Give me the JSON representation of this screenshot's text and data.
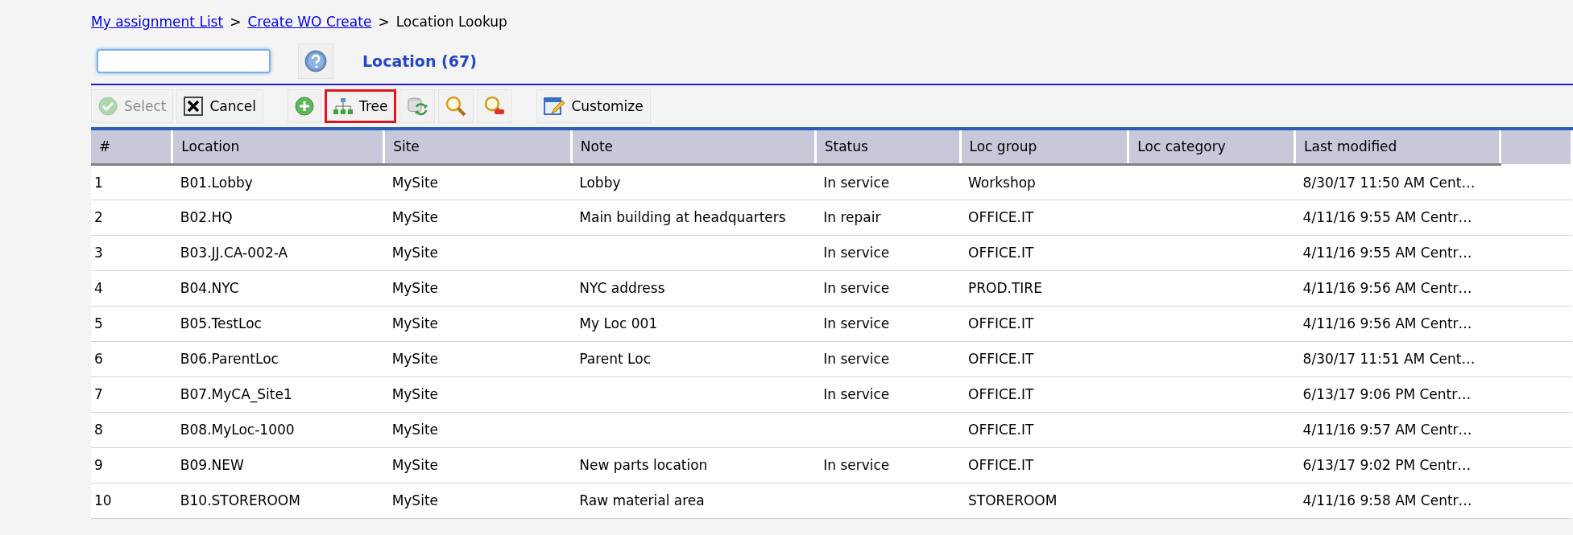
{
  "breadcrumb": [
    {
      "label": "My assignment List",
      "kind": "link"
    },
    {
      "label": ">",
      "kind": "separator"
    },
    {
      "label": "Create WO Create",
      "kind": "link"
    },
    {
      "label": ">",
      "kind": "separator"
    },
    {
      "label": "Location Lookup",
      "kind": "current"
    }
  ],
  "title": "Location (67)",
  "toolbar": [
    {
      "kind": "select",
      "label": "Select",
      "disabled": true,
      "highlighted": false
    },
    {
      "kind": "cancel",
      "label": "Cancel",
      "disabled": false,
      "highlighted": false
    },
    {
      "kind": "add",
      "disabled": false,
      "highlighted": false
    },
    {
      "kind": "tree",
      "label": "Tree",
      "disabled": false,
      "highlighted": true
    },
    {
      "kind": "refresh",
      "disabled": false,
      "highlighted": false
    },
    {
      "kind": "search",
      "disabled": false,
      "highlighted": false
    },
    {
      "kind": "clear-search",
      "disabled": false,
      "highlighted": false
    },
    {
      "kind": "customize",
      "label": "Customize",
      "disabled": false,
      "highlighted": false
    }
  ],
  "table": {
    "columns": [
      "#",
      "Location",
      "Site",
      "Note",
      "Status",
      "Loc group",
      "Loc category",
      "Last modified"
    ],
    "rows": [
      [
        "1",
        "B01.Lobby",
        "MySite",
        "Lobby",
        "In service",
        "Workshop",
        "",
        "8/30/17 11:50 AM Cent…"
      ],
      [
        "2",
        "B02.HQ",
        "MySite",
        "Main building at headquarters",
        "In repair",
        "OFFICE.IT",
        "",
        "4/11/16 9:55 AM Centr…"
      ],
      [
        "3",
        "B03.JJ.CA-002-A",
        "MySite",
        "",
        "In service",
        "OFFICE.IT",
        "",
        "4/11/16 9:55 AM Centr…"
      ],
      [
        "4",
        "B04.NYC",
        "MySite",
        "NYC address",
        "In service",
        "PROD.TIRE",
        "",
        "4/11/16 9:56 AM Centr…"
      ],
      [
        "5",
        "B05.TestLoc",
        "MySite",
        "My Loc 001",
        "In service",
        "OFFICE.IT",
        "",
        "4/11/16 9:56 AM Centr…"
      ],
      [
        "6",
        "B06.ParentLoc",
        "MySite",
        "Parent Loc",
        "In service",
        "OFFICE.IT",
        "",
        "8/30/17 11:51 AM Cent…"
      ],
      [
        "7",
        "B07.MyCA_Site1",
        "MySite",
        "",
        "In service",
        "OFFICE.IT",
        "",
        "6/13/17 9:06 PM Centr…"
      ],
      [
        "8",
        "B08.MyLoc-1000",
        "MySite",
        "",
        "",
        "OFFICE.IT",
        "",
        "4/11/16 9:57 AM Centr…"
      ],
      [
        "9",
        "B09.NEW",
        "MySite",
        "New parts location",
        "In service",
        "OFFICE.IT",
        "",
        "6/13/17 9:02 PM Centr…"
      ],
      [
        "10",
        "B10.STOREROOM",
        "MySite",
        "Raw material area",
        "",
        "STOREROOM",
        "",
        "4/11/16 9:58 AM Centr…"
      ]
    ]
  }
}
